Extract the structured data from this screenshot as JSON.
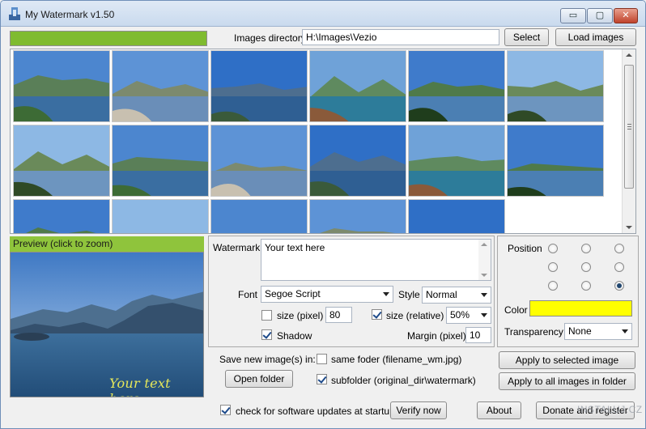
{
  "window": {
    "title": "My Watermark v1.50",
    "buttons": {
      "minimize": "▭",
      "maximize": "▢",
      "close": "✕"
    }
  },
  "header": {
    "progress": 1.0,
    "images_directory_label": "Images directory",
    "images_directory_value": "H:\\Images\\Vezio",
    "select_label": "Select",
    "load_images_label": "Load images"
  },
  "preview": {
    "heading": "Preview (click to zoom)",
    "overlay_text": "Your text here"
  },
  "settings": {
    "watermark_label": "Watermark",
    "watermark_text": "Your text here",
    "font_label": "Font",
    "font_value": "Segoe Script",
    "style_label": "Style",
    "style_value": "Normal",
    "size_pixel_label": "size (pixel)",
    "size_pixel_value": "80",
    "size_pixel_checked": false,
    "size_relative_label": "size (relative)",
    "size_relative_value": "50%",
    "size_relative_checked": true,
    "shadow_label": "Shadow",
    "shadow_checked": true,
    "margin_label": "Margin (pixel)",
    "margin_value": "10"
  },
  "position": {
    "label": "Position",
    "selected": "bottom-right",
    "color_label": "Color",
    "color_value": "#ffff00",
    "transparency_label": "Transparency",
    "transparency_value": "None"
  },
  "save": {
    "label": "Save new image(s) in:",
    "open_folder": "Open folder",
    "same_folder_label": "same foder (filename_wm.jpg)",
    "same_folder_checked": false,
    "subfolder_label": "subfolder (original_dir\\watermark)",
    "subfolder_checked": true,
    "apply_selected": "Apply to selected image",
    "apply_all": "Apply to all images in folder"
  },
  "footer": {
    "updates_label": "check for software updates at startup",
    "updates_checked": true,
    "verify_now": "Verify now",
    "about": "About",
    "donate": "Donate and register",
    "site_watermark": "INSTALUJ.CZ"
  },
  "thumbnails": [
    "lake-bay-photo",
    "tree-terrace-photo",
    "cypress-lake-photo",
    "village-shore-photo",
    "mountain-lake-photo",
    "statue-cypress-photo",
    "lake-island-photo",
    "castle-wall-photo",
    "hill-trees-photo",
    "gate-view-photo",
    "coast-town-photo",
    "wide-lake-photo",
    "hill-slope-photo",
    "stone-wall-photo",
    "sky-lake-photo",
    "ruin-wall-photo",
    "blue-lake-photo"
  ],
  "colors": {
    "accent_green": "#8fc43c",
    "progress_green": "#7fbb30",
    "watermark_yellow": "#ffff00"
  }
}
